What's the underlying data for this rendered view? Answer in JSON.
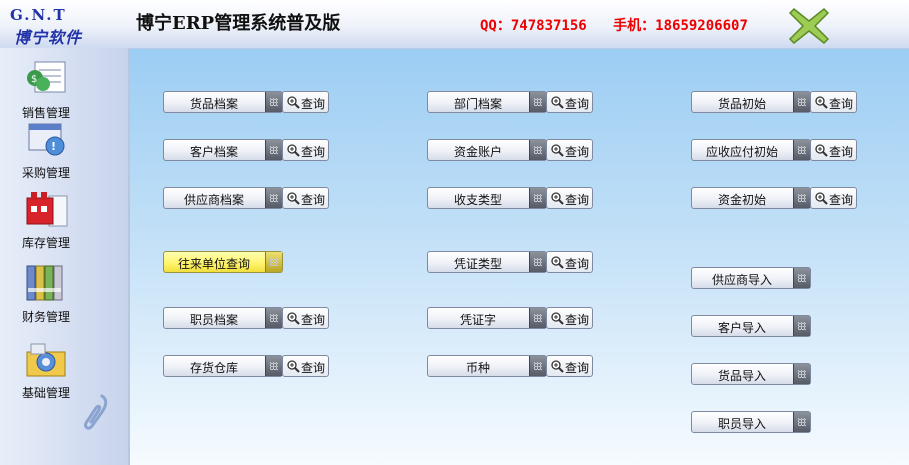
{
  "header": {
    "logo_top": "G.N.T",
    "logo_bottom": "博宁软件",
    "title": "博宁ERP管理系统普及版",
    "qq": "QQ：747837156",
    "phone": "手机：18659206607"
  },
  "sidebar": {
    "items": [
      {
        "label": "销售管理",
        "icon": "sales-icon"
      },
      {
        "label": "采购管理",
        "icon": "purchase-icon"
      },
      {
        "label": "库存管理",
        "icon": "inventory-icon"
      },
      {
        "label": "财务管理",
        "icon": "finance-icon"
      },
      {
        "label": "基础管理",
        "icon": "basic-icon"
      }
    ]
  },
  "query_label": "查询",
  "columns": {
    "left": [
      "货品档案",
      "客户档案",
      "供应商档案",
      "往来单位查询",
      "职员档案",
      "存货仓库"
    ],
    "middle": [
      "部门档案",
      "资金账户",
      "收支类型",
      "凭证类型",
      "凭证字",
      "币种"
    ],
    "right": [
      "货品初始",
      "应收应付初始",
      "资金初始"
    ],
    "imports": [
      "供应商导入",
      "客户导入",
      "货品导入",
      "职员导入"
    ]
  },
  "colors": {
    "title_red": "#e00000",
    "highlight_yellow": "#fff36a",
    "main_bg_top": "#9ccdf3"
  }
}
